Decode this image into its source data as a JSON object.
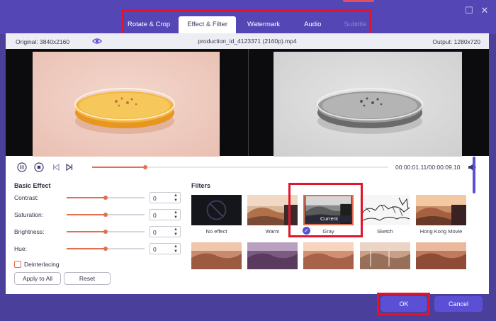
{
  "window": {
    "restore_glyph": "☐",
    "close_glyph": "✕"
  },
  "tabs": [
    {
      "label": "Rotate & Crop",
      "state": "normal"
    },
    {
      "label": "Effect & Filter",
      "state": "active"
    },
    {
      "label": "Watermark",
      "state": "normal"
    },
    {
      "label": "Audio",
      "state": "normal"
    },
    {
      "label": "Subtitle",
      "state": "disabled"
    }
  ],
  "info": {
    "original": "Original: 3840x2160",
    "filename": "production_id_4123371 (2160p).mp4",
    "output": "Output: 1280x720"
  },
  "playback": {
    "time": "00:00:01.11/00:00:09.10",
    "progress": 0.18
  },
  "basic_effect": {
    "title": "Basic Effect",
    "rows": [
      {
        "label": "Contrast:",
        "value": "0",
        "level": 0.5
      },
      {
        "label": "Saturation:",
        "value": "0",
        "level": 0.5
      },
      {
        "label": "Brightness:",
        "value": "0",
        "level": 0.5
      },
      {
        "label": "Hue:",
        "value": "0",
        "level": 0.5
      }
    ],
    "deinterlacing": "Deinterlacing",
    "apply_all": "Apply to All",
    "reset": "Reset"
  },
  "filters": {
    "title": "Filters",
    "current_tag": "Current",
    "items": [
      {
        "label": "No effect"
      },
      {
        "label": "Warm"
      },
      {
        "label": "Gray",
        "selected": true
      },
      {
        "label": "Sketch"
      },
      {
        "label": "Hong Kong Movie"
      }
    ]
  },
  "actions": {
    "ok": "OK",
    "cancel": "Cancel"
  },
  "colors": {
    "accent": "#5b4fd6",
    "brand_bar": "#5546b6",
    "slider": "#e26f4e",
    "highlight": "#e2142c"
  },
  "icons": [
    "eye-icon",
    "pause-icon",
    "stop-icon",
    "prev-frame-icon",
    "next-frame-icon",
    "volume-icon",
    "check-icon",
    "no-effect-icon"
  ]
}
